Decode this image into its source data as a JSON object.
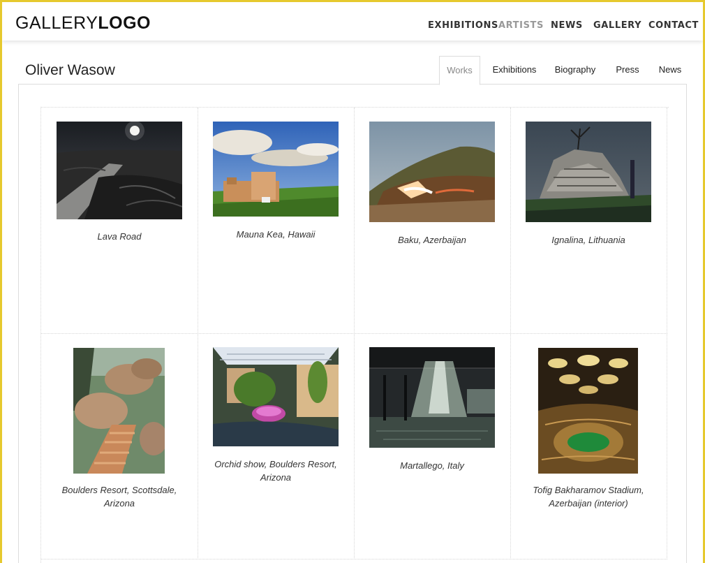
{
  "header": {
    "logo_light": "GALLERY",
    "logo_bold": "LOGO",
    "nav": [
      {
        "label": "EXHIBITIONS",
        "active": false
      },
      {
        "label": "ARTISTS",
        "active": true
      },
      {
        "label": "NEWS",
        "active": false
      },
      {
        "label": "GALLERY",
        "active": false
      },
      {
        "label": "CONTACT",
        "active": false
      }
    ]
  },
  "artist": {
    "name": "Oliver Wasow",
    "tabs": [
      {
        "label": "Works",
        "active": true
      },
      {
        "label": "Exhibitions",
        "active": false
      },
      {
        "label": "Biography",
        "active": false
      },
      {
        "label": "Press",
        "active": false
      },
      {
        "label": "News",
        "active": false
      }
    ]
  },
  "works": [
    {
      "title": "Lava Road",
      "image": "lava-road-photo"
    },
    {
      "title": "Mauna Kea, Hawaii",
      "image": "mauna-kea-photo"
    },
    {
      "title": "Baku, Azerbaijan",
      "image": "baku-photo"
    },
    {
      "title": "Ignalina, Lithuania",
      "image": "ignalina-photo"
    },
    {
      "title": "Boulders Resort, Scottsdale, Arizona",
      "image": "boulders-resort-photo"
    },
    {
      "title": "Orchid show, Boulders Resort, Arizona",
      "image": "orchid-show-photo"
    },
    {
      "title": "Martallego, Italy",
      "image": "martallego-photo"
    },
    {
      "title": "Tofig Bakharamov Stadium, Azerbaijan (interior)",
      "image": "stadium-photo"
    }
  ]
}
